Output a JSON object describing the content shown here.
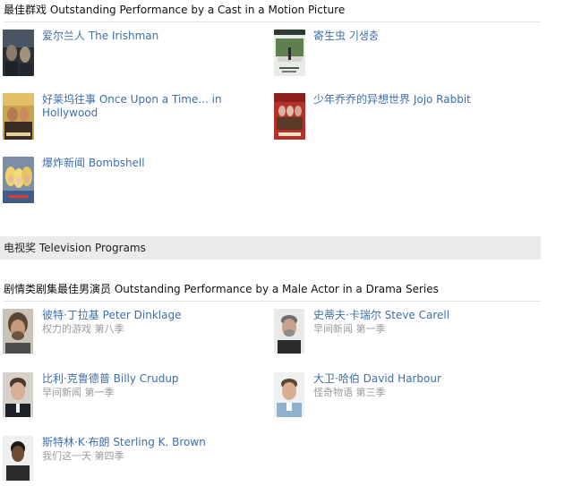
{
  "section1": {
    "title": "最佳群戏 Outstanding Performance by a Cast in a Motion Picture",
    "items": [
      {
        "name": "爱尔兰人 The Irishman"
      },
      {
        "name": "寄生虫 기생충"
      },
      {
        "name": "好莱坞往事 Once Upon a Time... in Hollywood"
      },
      {
        "name": "少年乔乔的异想世界 Jojo Rabbit"
      },
      {
        "name": "爆炸新闻 Bombshell"
      }
    ]
  },
  "tv_band": {
    "label": "电视奖 Television Programs"
  },
  "section2": {
    "title": "剧情类剧集最佳男演员 Outstanding Performance by a Male Actor in a Drama Series",
    "items": [
      {
        "name": "彼特·丁拉基 Peter Dinklage",
        "show": "权力的游戏 第八季"
      },
      {
        "name": "史蒂夫·卡瑞尔 Steve Carell",
        "show": "早间新闻 第一季"
      },
      {
        "name": "比利·克鲁德普 Billy Crudup",
        "show": "早间新闻 第一季"
      },
      {
        "name": "大卫·哈伯 David Harbour",
        "show": "怪奇物语 第三季"
      },
      {
        "name": "斯特林·K·布朗 Sterling K. Brown",
        "show": "我们这一天 第四季"
      }
    ]
  }
}
